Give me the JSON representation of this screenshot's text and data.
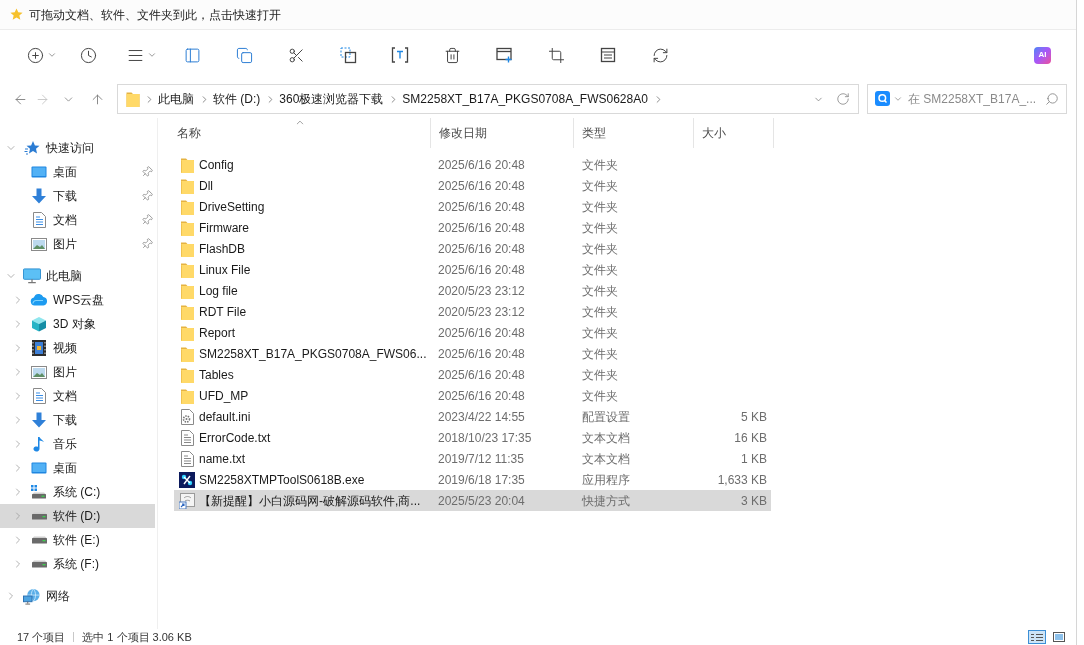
{
  "quick_access_bar": {
    "text": "可拖动文档、软件、文件夹到此，点击快速打开"
  },
  "toolbar": {
    "ai_button": "AI"
  },
  "navigation": {
    "buttons": [
      {
        "kind": "back",
        "disabled": false
      },
      {
        "kind": "forward",
        "disabled": true
      },
      {
        "kind": "recent",
        "disabled": false
      },
      {
        "kind": "up",
        "disabled": false
      }
    ]
  },
  "address_bar": {
    "breadcrumbs": [
      "此电脑",
      "软件 (D:)",
      "360极速浏览器下载",
      "SM2258XT_B17A_PKGS0708A_FWS0628A0"
    ]
  },
  "search": {
    "placeholder": "在 SM2258XT_B17A_..."
  },
  "sidebar": {
    "items": [
      {
        "label": "快速访问",
        "kind": "quick_access",
        "expanded": true,
        "selected": false,
        "children": [
          {
            "label": "桌面",
            "kind": "desktop",
            "pinned": true,
            "selected": false
          },
          {
            "label": "下载",
            "kind": "downloads",
            "pinned": true,
            "selected": false
          },
          {
            "label": "文档",
            "kind": "documents",
            "pinned": true,
            "selected": false
          },
          {
            "label": "图片",
            "kind": "pictures",
            "pinned": true,
            "selected": false
          }
        ]
      },
      {
        "label": "此电脑",
        "kind": "this_pc",
        "expanded": true,
        "selected": false,
        "children": [
          {
            "label": "WPS云盘",
            "kind": "cloud",
            "expanded": false,
            "selected": false
          },
          {
            "label": "3D 对象",
            "kind": "objects_3d",
            "expanded": false,
            "selected": false
          },
          {
            "label": "视频",
            "kind": "videos",
            "expanded": false,
            "selected": false
          },
          {
            "label": "图片",
            "kind": "pictures",
            "expanded": false,
            "selected": false
          },
          {
            "label": "文档",
            "kind": "documents",
            "expanded": false,
            "selected": false
          },
          {
            "label": "下载",
            "kind": "downloads",
            "expanded": false,
            "selected": false
          },
          {
            "label": "音乐",
            "kind": "music",
            "expanded": false,
            "selected": false
          },
          {
            "label": "桌面",
            "kind": "desktop",
            "expanded": false,
            "selected": false
          },
          {
            "label": "系统 (C:)",
            "kind": "system_drive",
            "expanded": false,
            "selected": false
          },
          {
            "label": "软件 (D:)",
            "kind": "drive",
            "expanded": false,
            "selected": true
          },
          {
            "label": "软件 (E:)",
            "kind": "drive",
            "expanded": false,
            "selected": false
          },
          {
            "label": "系统 (F:)",
            "kind": "drive",
            "expanded": false,
            "selected": false
          }
        ]
      },
      {
        "label": "网络",
        "kind": "network",
        "expanded": false,
        "selected": false
      }
    ]
  },
  "file_list": {
    "columns": [
      {
        "label": "名称",
        "sorted": true
      },
      {
        "label": "修改日期",
        "sorted": false
      },
      {
        "label": "类型",
        "sorted": false
      },
      {
        "label": "大小",
        "sorted": false
      }
    ],
    "rows": [
      {
        "name": "Config",
        "modified": "2025/6/16 20:48",
        "type": "文件夹",
        "kind": "folder",
        "selected": false
      },
      {
        "name": "Dll",
        "modified": "2025/6/16 20:48",
        "type": "文件夹",
        "kind": "folder",
        "selected": false
      },
      {
        "name": "DriveSetting",
        "modified": "2025/6/16 20:48",
        "type": "文件夹",
        "kind": "folder",
        "selected": false
      },
      {
        "name": "Firmware",
        "modified": "2025/6/16 20:48",
        "type": "文件夹",
        "kind": "folder",
        "selected": false
      },
      {
        "name": "FlashDB",
        "modified": "2025/6/16 20:48",
        "type": "文件夹",
        "kind": "folder",
        "selected": false
      },
      {
        "name": "Linux File",
        "modified": "2025/6/16 20:48",
        "type": "文件夹",
        "kind": "folder",
        "selected": false
      },
      {
        "name": "Log file",
        "modified": "2020/5/23 23:12",
        "type": "文件夹",
        "kind": "folder",
        "selected": false
      },
      {
        "name": "RDT File",
        "modified": "2020/5/23 23:12",
        "type": "文件夹",
        "kind": "folder",
        "selected": false
      },
      {
        "name": "Report",
        "modified": "2025/6/16 20:48",
        "type": "文件夹",
        "kind": "folder",
        "selected": false
      },
      {
        "name": "SM2258XT_B17A_PKGS0708A_FWS06...",
        "modified": "2025/6/16 20:48",
        "type": "文件夹",
        "kind": "folder",
        "selected": false
      },
      {
        "name": "Tables",
        "modified": "2025/6/16 20:48",
        "type": "文件夹",
        "kind": "folder",
        "selected": false
      },
      {
        "name": "UFD_MP",
        "modified": "2025/6/16 20:48",
        "type": "文件夹",
        "kind": "folder",
        "selected": false
      },
      {
        "name": "default.ini",
        "modified": "2023/4/22 14:55",
        "type": "配置设置",
        "size": "5 KB",
        "kind": "settings",
        "selected": false
      },
      {
        "name": "ErrorCode.txt",
        "modified": "2018/10/23 17:35",
        "type": "文本文档",
        "size": "16 KB",
        "kind": "text",
        "selected": false
      },
      {
        "name": "name.txt",
        "modified": "2019/7/12 11:35",
        "type": "文本文档",
        "size": "1 KB",
        "kind": "text",
        "selected": false
      },
      {
        "name": "SM2258XTMPToolS0618B.exe",
        "modified": "2019/6/18 17:35",
        "type": "应用程序",
        "size": "1,633 KB",
        "kind": "program",
        "selected": false
      },
      {
        "name": "【新提醒】小白源码网-破解源码软件,商...",
        "modified": "2025/5/23 20:04",
        "type": "快捷方式",
        "size": "3 KB",
        "kind": "shortcut",
        "selected": true
      }
    ]
  },
  "status_bar": {
    "item_count": "17 个项目",
    "selection": "选中 1 个项目 3.06 KB",
    "view_modes": [
      {
        "kind": "details",
        "selected": true
      },
      {
        "kind": "thumbnails",
        "selected": false
      }
    ]
  }
}
